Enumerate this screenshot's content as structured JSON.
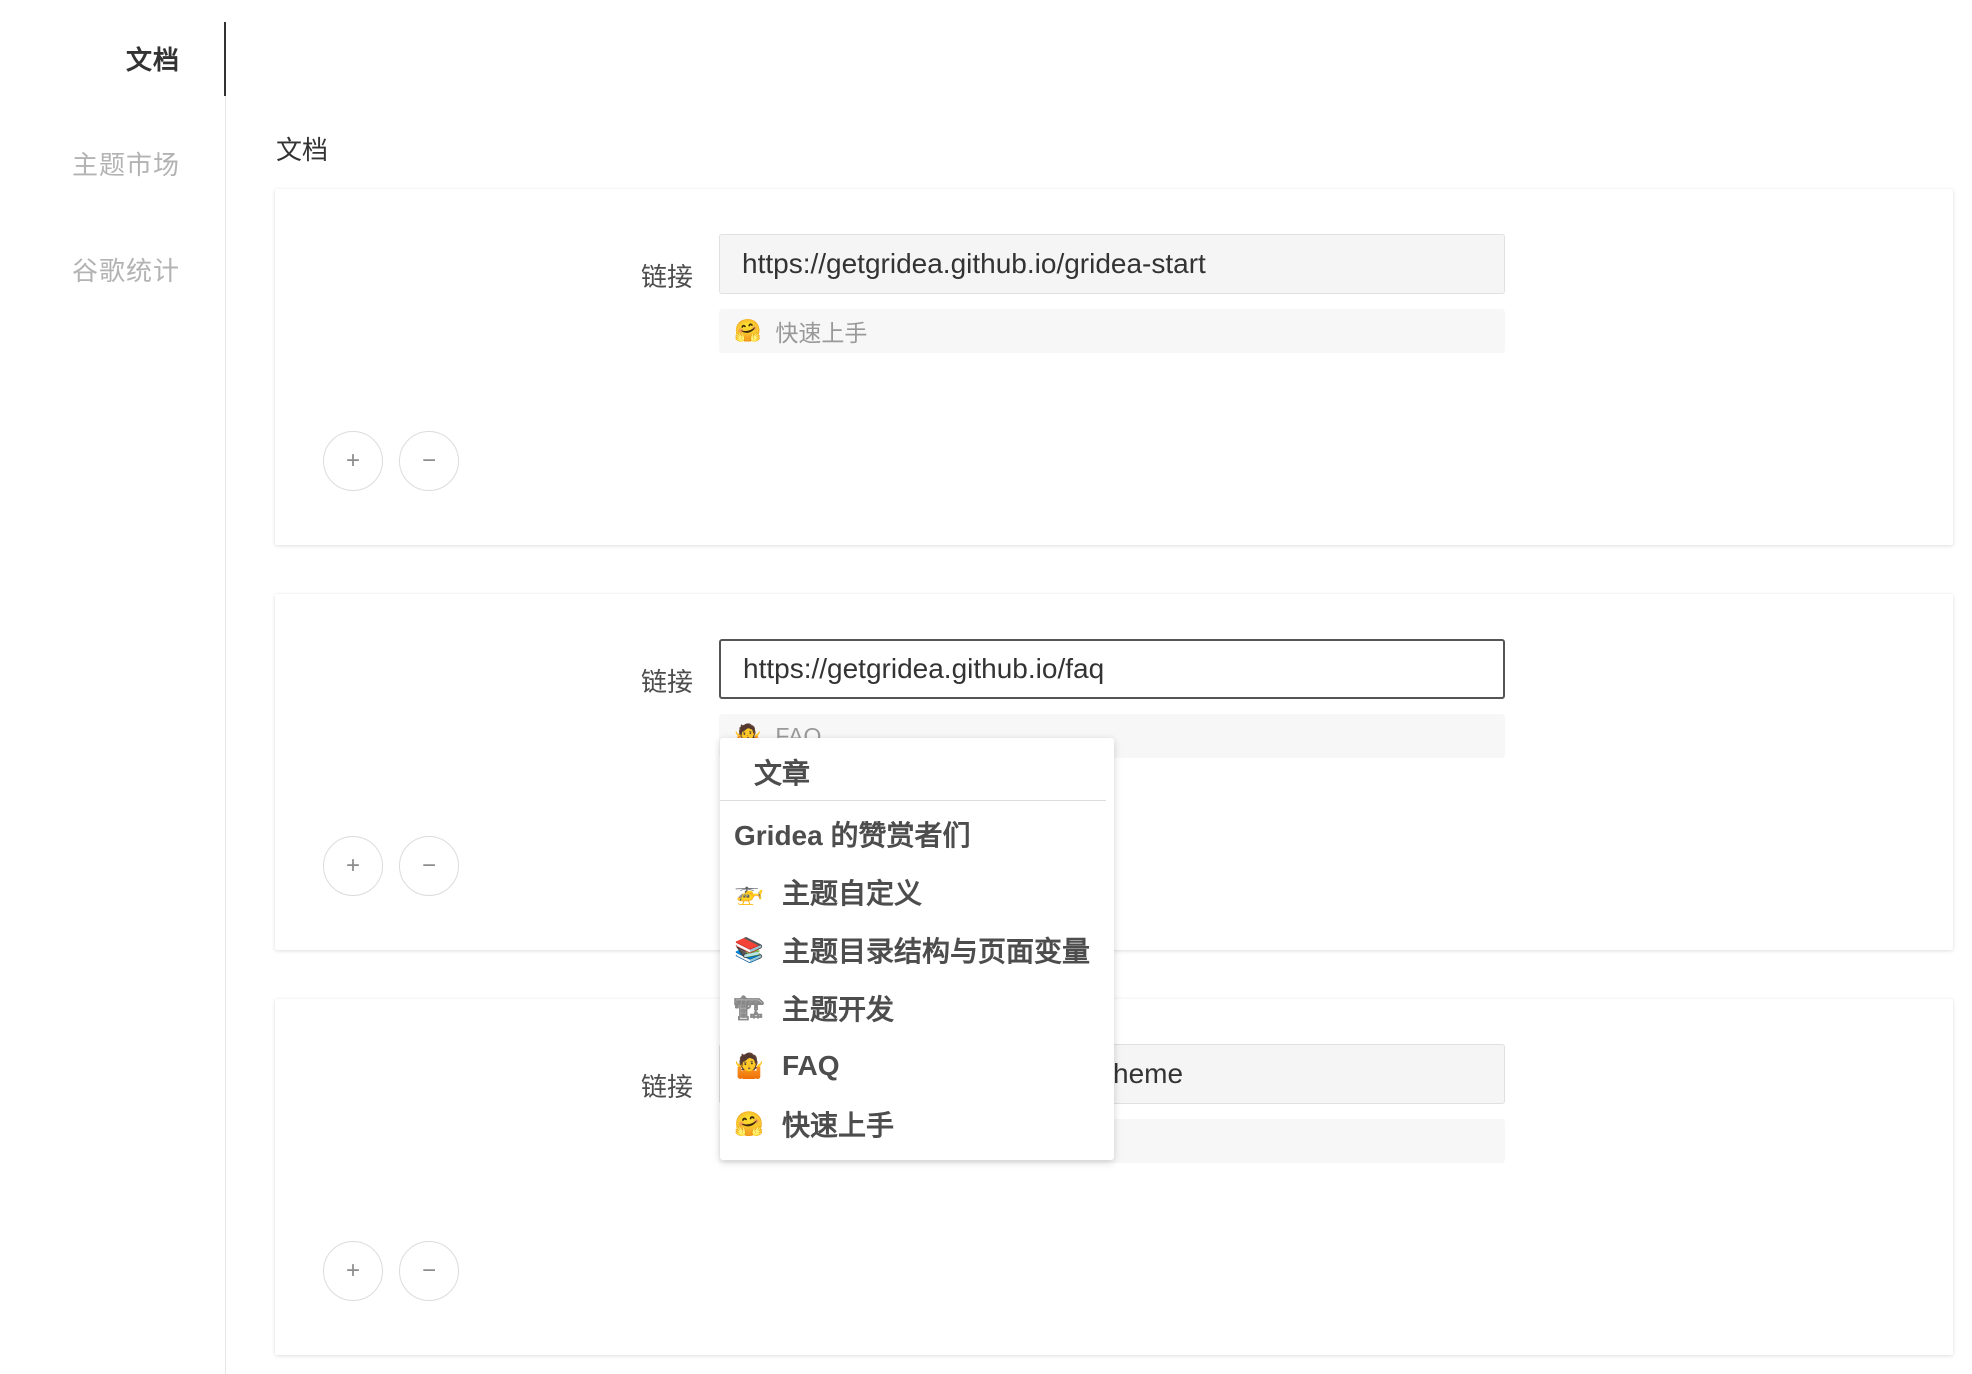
{
  "sidebar": {
    "tabs": [
      {
        "label": "文档",
        "active": true
      },
      {
        "label": "主题市场",
        "active": false
      },
      {
        "label": "谷歌统计",
        "active": false
      }
    ]
  },
  "main": {
    "section_title": "文档",
    "link_label": "链接",
    "add_button": "+",
    "remove_button": "−",
    "cards": [
      {
        "url": "https://getgridea.github.io/gridea-start",
        "selected_emoji": "🤗",
        "selected_title": "快速上手"
      },
      {
        "url": "https://getgridea.github.io/faq",
        "selected_emoji": "🤷",
        "selected_title": "FAQ"
      },
      {
        "url": "heme",
        "selected_emoji": "",
        "selected_title": ""
      }
    ]
  },
  "dropdown": {
    "group_label": "文章",
    "options": [
      {
        "emoji": "",
        "title": "Gridea 的赞赏者们"
      },
      {
        "emoji": "🚁",
        "title": "主题自定义"
      },
      {
        "emoji": "📚",
        "title": "主题目录结构与页面变量"
      },
      {
        "emoji": "🏗",
        "title": "主题开发"
      },
      {
        "emoji": "🤷",
        "title": "FAQ"
      },
      {
        "emoji": "🤗",
        "title": "快速上手"
      }
    ]
  }
}
